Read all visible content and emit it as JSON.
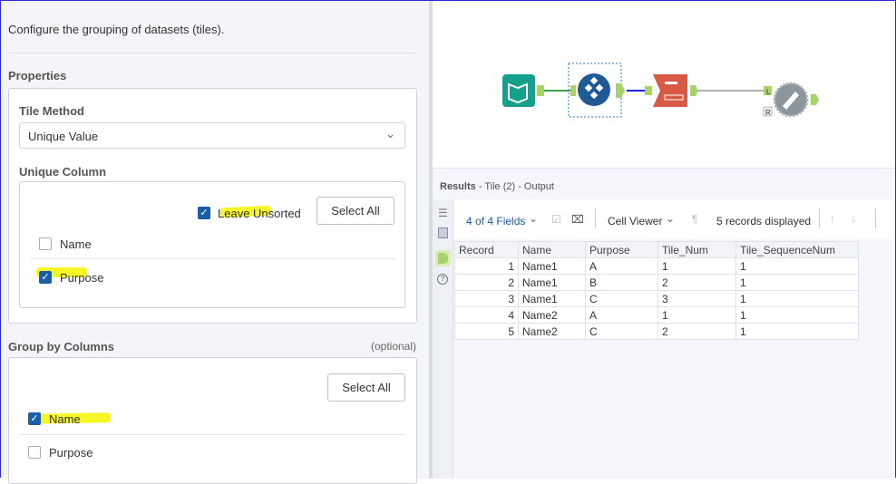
{
  "config": {
    "description": "Configure the grouping of datasets (tiles).",
    "properties_label": "Properties",
    "tile_method_label": "Tile Method",
    "tile_method_value": "Unique Value",
    "unique_column_label": "Unique Column",
    "leave_unsorted_label": "Leave Unsorted",
    "leave_unsorted_checked": true,
    "select_all_label": "Select All",
    "unique_columns": [
      {
        "label": "Name",
        "checked": false
      },
      {
        "label": "Purpose",
        "checked": true
      }
    ],
    "group_by_label": "Group by Columns",
    "optional_label": "(optional)",
    "group_by_columns": [
      {
        "label": "Name",
        "checked": true
      },
      {
        "label": "Purpose",
        "checked": false
      }
    ],
    "highlight_color": "#f5f500"
  },
  "canvas": {
    "tools": [
      "input-data-icon",
      "tile-tool-icon",
      "sort-tool-icon",
      "join-tool-icon"
    ],
    "anchors": {
      "left": "L",
      "right": "R"
    }
  },
  "results": {
    "title": "Results",
    "subtitle": "- Tile (2) - Output",
    "fields_label": "4 of 4 Fields",
    "viewer_label": "Cell Viewer",
    "records_label": "5 records displayed",
    "columns": [
      "Record",
      "Name",
      "Purpose",
      "Tile_Num",
      "Tile_SequenceNum"
    ],
    "rows": [
      [
        "1",
        "Name1",
        "A",
        "1",
        "1"
      ],
      [
        "2",
        "Name1",
        "B",
        "2",
        "1"
      ],
      [
        "3",
        "Name1",
        "C",
        "3",
        "1"
      ],
      [
        "4",
        "Name2",
        "A",
        "1",
        "1"
      ],
      [
        "5",
        "Name2",
        "C",
        "2",
        "1"
      ]
    ]
  }
}
